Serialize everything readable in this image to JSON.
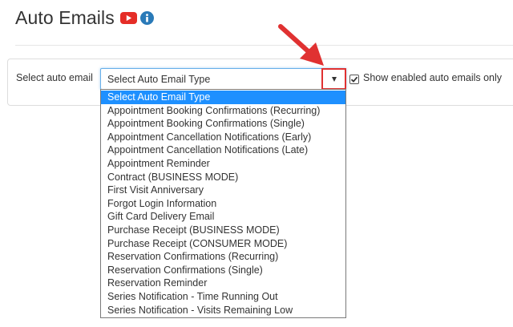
{
  "header": {
    "title": "Auto Emails",
    "video_icon": "youtube-play-icon",
    "info_icon": "info-icon"
  },
  "form": {
    "select_label": "Select auto email",
    "select_value": "Select Auto Email Type",
    "dropdown_icon": "caret-down-icon",
    "checkbox_checked": true,
    "checkbox_label": "Show enabled auto emails only"
  },
  "dropdown": {
    "selected_index": 0,
    "options": [
      "Select Auto Email Type",
      "Appointment Booking Confirmations (Recurring)",
      "Appointment Booking Confirmations (Single)",
      "Appointment Cancellation Notifications (Early)",
      "Appointment Cancellation Notifications (Late)",
      "Appointment Reminder",
      "Contract (BUSINESS MODE)",
      "First Visit Anniversary",
      "Forgot Login Information",
      "Gift Card Delivery Email",
      "Purchase Receipt (BUSINESS MODE)",
      "Purchase Receipt (CONSUMER MODE)",
      "Reservation Confirmations (Recurring)",
      "Reservation Confirmations (Single)",
      "Reservation Reminder",
      "Series Notification - Time Running Out",
      "Series Notification - Visits Remaining Low"
    ]
  },
  "colors": {
    "highlight": "#1e90ff",
    "annotation_red": "#e03131",
    "focus_border": "#66afe9",
    "video_red": "#e52d27",
    "info_blue": "#2a7ab8"
  }
}
